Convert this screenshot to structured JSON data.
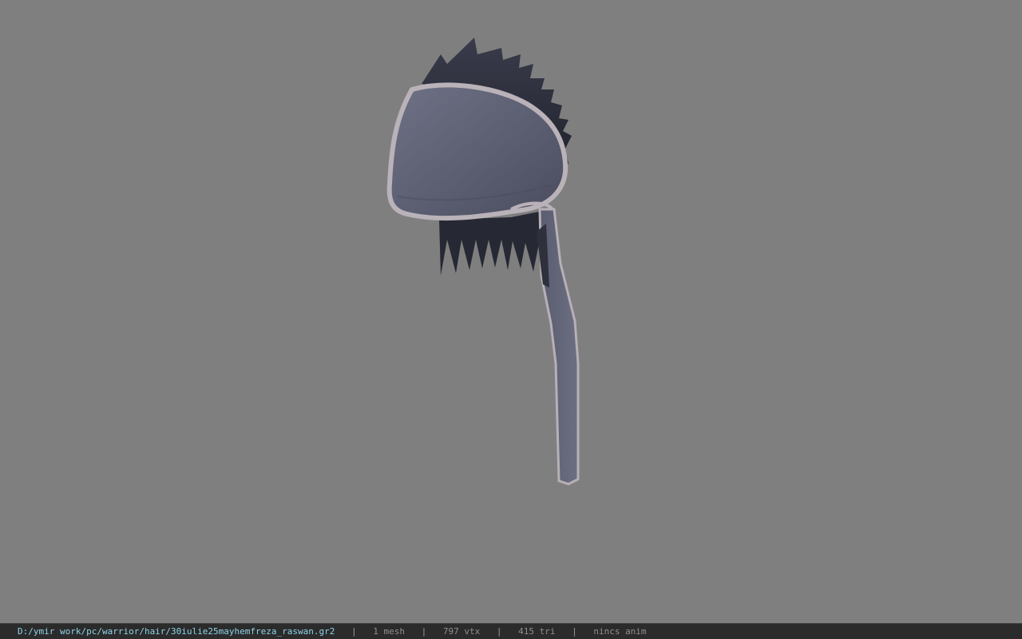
{
  "viewport": {
    "background_color": "#7f7f7f",
    "model_colors": {
      "hat_fill": "#5b5d70",
      "hat_trim": "#b7b0b6",
      "hair_dark": "#2a2c37"
    }
  },
  "status_bar": {
    "file_path": "D:/ymir work/pc/warrior/hair/30iulie25mayhemfreza_raswan.gr2",
    "separator": "|",
    "mesh_count": "1 mesh",
    "vertex_count": "797 vtx",
    "triangle_count": "415 tri",
    "animation": "nincs anim",
    "path_color": "#8fd3e8"
  }
}
